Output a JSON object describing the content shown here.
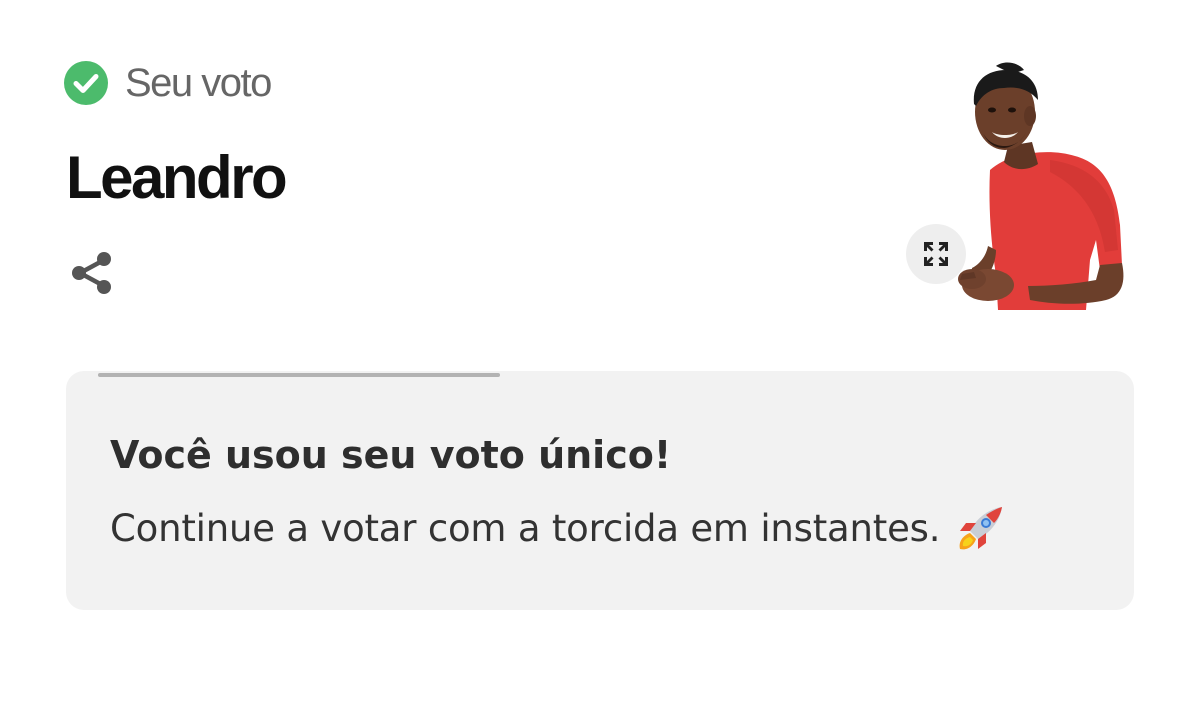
{
  "status": {
    "label": "Seu voto",
    "icon": "check-circle-icon",
    "color": "#4cbb6c"
  },
  "participant": {
    "name": "Leandro",
    "shirt_color": "#e23d3a"
  },
  "actions": {
    "share_icon": "share-icon",
    "expand_icon": "expand-icon"
  },
  "message": {
    "title": "Você usou seu voto único!",
    "text": "Continue a votar com a torcida em instantes.",
    "emoji": "rocket-icon",
    "progress": 0.4,
    "background": "#f2f2f2"
  }
}
